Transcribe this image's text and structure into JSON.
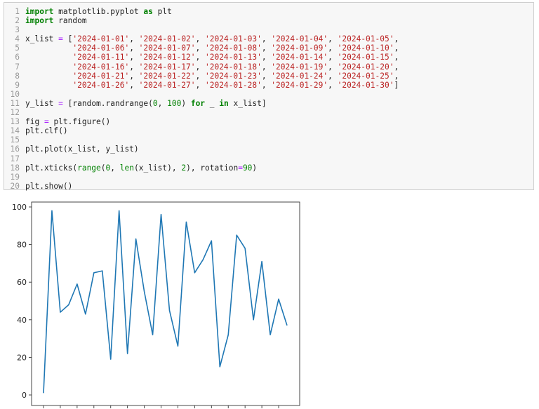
{
  "code_cell": {
    "lines": [
      [
        [
          "import",
          "kw"
        ],
        [
          " matplotlib.pyplot ",
          ""
        ],
        [
          "as",
          "kw"
        ],
        [
          " plt",
          ""
        ]
      ],
      [
        [
          "import",
          "kw"
        ],
        [
          " random",
          ""
        ]
      ],
      [],
      [
        [
          "x_list ",
          ""
        ],
        [
          "=",
          "op"
        ],
        [
          " [",
          ""
        ],
        [
          "'2024-01-01'",
          "st"
        ],
        [
          ", ",
          ""
        ],
        [
          "'2024-01-02'",
          "st"
        ],
        [
          ", ",
          ""
        ],
        [
          "'2024-01-03'",
          "st"
        ],
        [
          ", ",
          ""
        ],
        [
          "'2024-01-04'",
          "st"
        ],
        [
          ", ",
          ""
        ],
        [
          "'2024-01-05'",
          "st"
        ],
        [
          ",",
          ""
        ]
      ],
      [
        [
          "          ",
          ""
        ],
        [
          "'2024-01-06'",
          "st"
        ],
        [
          ", ",
          ""
        ],
        [
          "'2024-01-07'",
          "st"
        ],
        [
          ", ",
          ""
        ],
        [
          "'2024-01-08'",
          "st"
        ],
        [
          ", ",
          ""
        ],
        [
          "'2024-01-09'",
          "st"
        ],
        [
          ", ",
          ""
        ],
        [
          "'2024-01-10'",
          "st"
        ],
        [
          ",",
          ""
        ]
      ],
      [
        [
          "          ",
          ""
        ],
        [
          "'2024-01-11'",
          "st"
        ],
        [
          ", ",
          ""
        ],
        [
          "'2024-01-12'",
          "st"
        ],
        [
          ", ",
          ""
        ],
        [
          "'2024-01-13'",
          "st"
        ],
        [
          ", ",
          ""
        ],
        [
          "'2024-01-14'",
          "st"
        ],
        [
          ", ",
          ""
        ],
        [
          "'2024-01-15'",
          "st"
        ],
        [
          ",",
          ""
        ]
      ],
      [
        [
          "          ",
          ""
        ],
        [
          "'2024-01-16'",
          "st"
        ],
        [
          ", ",
          ""
        ],
        [
          "'2024-01-17'",
          "st"
        ],
        [
          ", ",
          ""
        ],
        [
          "'2024-01-18'",
          "st"
        ],
        [
          ", ",
          ""
        ],
        [
          "'2024-01-19'",
          "st"
        ],
        [
          ", ",
          ""
        ],
        [
          "'2024-01-20'",
          "st"
        ],
        [
          ",",
          ""
        ]
      ],
      [
        [
          "          ",
          ""
        ],
        [
          "'2024-01-21'",
          "st"
        ],
        [
          ", ",
          ""
        ],
        [
          "'2024-01-22'",
          "st"
        ],
        [
          ", ",
          ""
        ],
        [
          "'2024-01-23'",
          "st"
        ],
        [
          ", ",
          ""
        ],
        [
          "'2024-01-24'",
          "st"
        ],
        [
          ", ",
          ""
        ],
        [
          "'2024-01-25'",
          "st"
        ],
        [
          ",",
          ""
        ]
      ],
      [
        [
          "          ",
          ""
        ],
        [
          "'2024-01-26'",
          "st"
        ],
        [
          ", ",
          ""
        ],
        [
          "'2024-01-27'",
          "st"
        ],
        [
          ", ",
          ""
        ],
        [
          "'2024-01-28'",
          "st"
        ],
        [
          ", ",
          ""
        ],
        [
          "'2024-01-29'",
          "st"
        ],
        [
          ", ",
          ""
        ],
        [
          "'2024-01-30'",
          "st"
        ],
        [
          "]",
          ""
        ]
      ],
      [],
      [
        [
          "y_list ",
          ""
        ],
        [
          "=",
          "op"
        ],
        [
          " [random.randrange(",
          ""
        ],
        [
          "0",
          "nu"
        ],
        [
          ", ",
          ""
        ],
        [
          "100",
          "nu"
        ],
        [
          ") ",
          ""
        ],
        [
          "for",
          "kw"
        ],
        [
          " _ ",
          ""
        ],
        [
          "in",
          "kw"
        ],
        [
          " x_list]",
          ""
        ]
      ],
      [],
      [
        [
          "fig ",
          ""
        ],
        [
          "=",
          "op"
        ],
        [
          " plt.figure()",
          ""
        ]
      ],
      [
        [
          "plt.clf()",
          ""
        ]
      ],
      [],
      [
        [
          "plt.plot(x_list, y_list)",
          ""
        ]
      ],
      [],
      [
        [
          "plt.xticks(",
          ""
        ],
        [
          "range",
          "nu"
        ],
        [
          "(",
          ""
        ],
        [
          "0",
          "nu"
        ],
        [
          ", ",
          ""
        ],
        [
          "len",
          "nu"
        ],
        [
          "(x_list), ",
          ""
        ],
        [
          "2",
          "nu"
        ],
        [
          "), rotation",
          ""
        ],
        [
          "=",
          "op"
        ],
        [
          "90",
          "nu"
        ],
        [
          ")",
          ""
        ]
      ],
      [],
      [
        [
          "plt.show()",
          ""
        ]
      ]
    ]
  },
  "chart_data": {
    "type": "line",
    "x": [
      "2024-01-01",
      "2024-01-02",
      "2024-01-03",
      "2024-01-04",
      "2024-01-05",
      "2024-01-06",
      "2024-01-07",
      "2024-01-08",
      "2024-01-09",
      "2024-01-10",
      "2024-01-11",
      "2024-01-12",
      "2024-01-13",
      "2024-01-14",
      "2024-01-15",
      "2024-01-16",
      "2024-01-17",
      "2024-01-18",
      "2024-01-19",
      "2024-01-20",
      "2024-01-21",
      "2024-01-22",
      "2024-01-23",
      "2024-01-24",
      "2024-01-25",
      "2024-01-26",
      "2024-01-27",
      "2024-01-28",
      "2024-01-29",
      "2024-01-30"
    ],
    "values": [
      1,
      98,
      44,
      48,
      59,
      43,
      65,
      66,
      19,
      98,
      22,
      83,
      55,
      32,
      96,
      45,
      26,
      92,
      65,
      72,
      82,
      15,
      32,
      85,
      78,
      40,
      71,
      32,
      51,
      37
    ],
    "y_ticks": [
      "0",
      "20",
      "40",
      "60",
      "80",
      "100"
    ],
    "x_tick_indices": [
      0,
      2,
      4,
      6,
      8,
      10,
      12,
      14,
      16,
      18,
      20,
      22,
      24,
      26,
      28
    ],
    "ylim": [
      -3.85,
      102.85
    ],
    "xlim": [
      -1.45,
      30.45
    ],
    "line_color": "#1f77b4",
    "title": "",
    "xlabel": "",
    "ylabel": ""
  }
}
